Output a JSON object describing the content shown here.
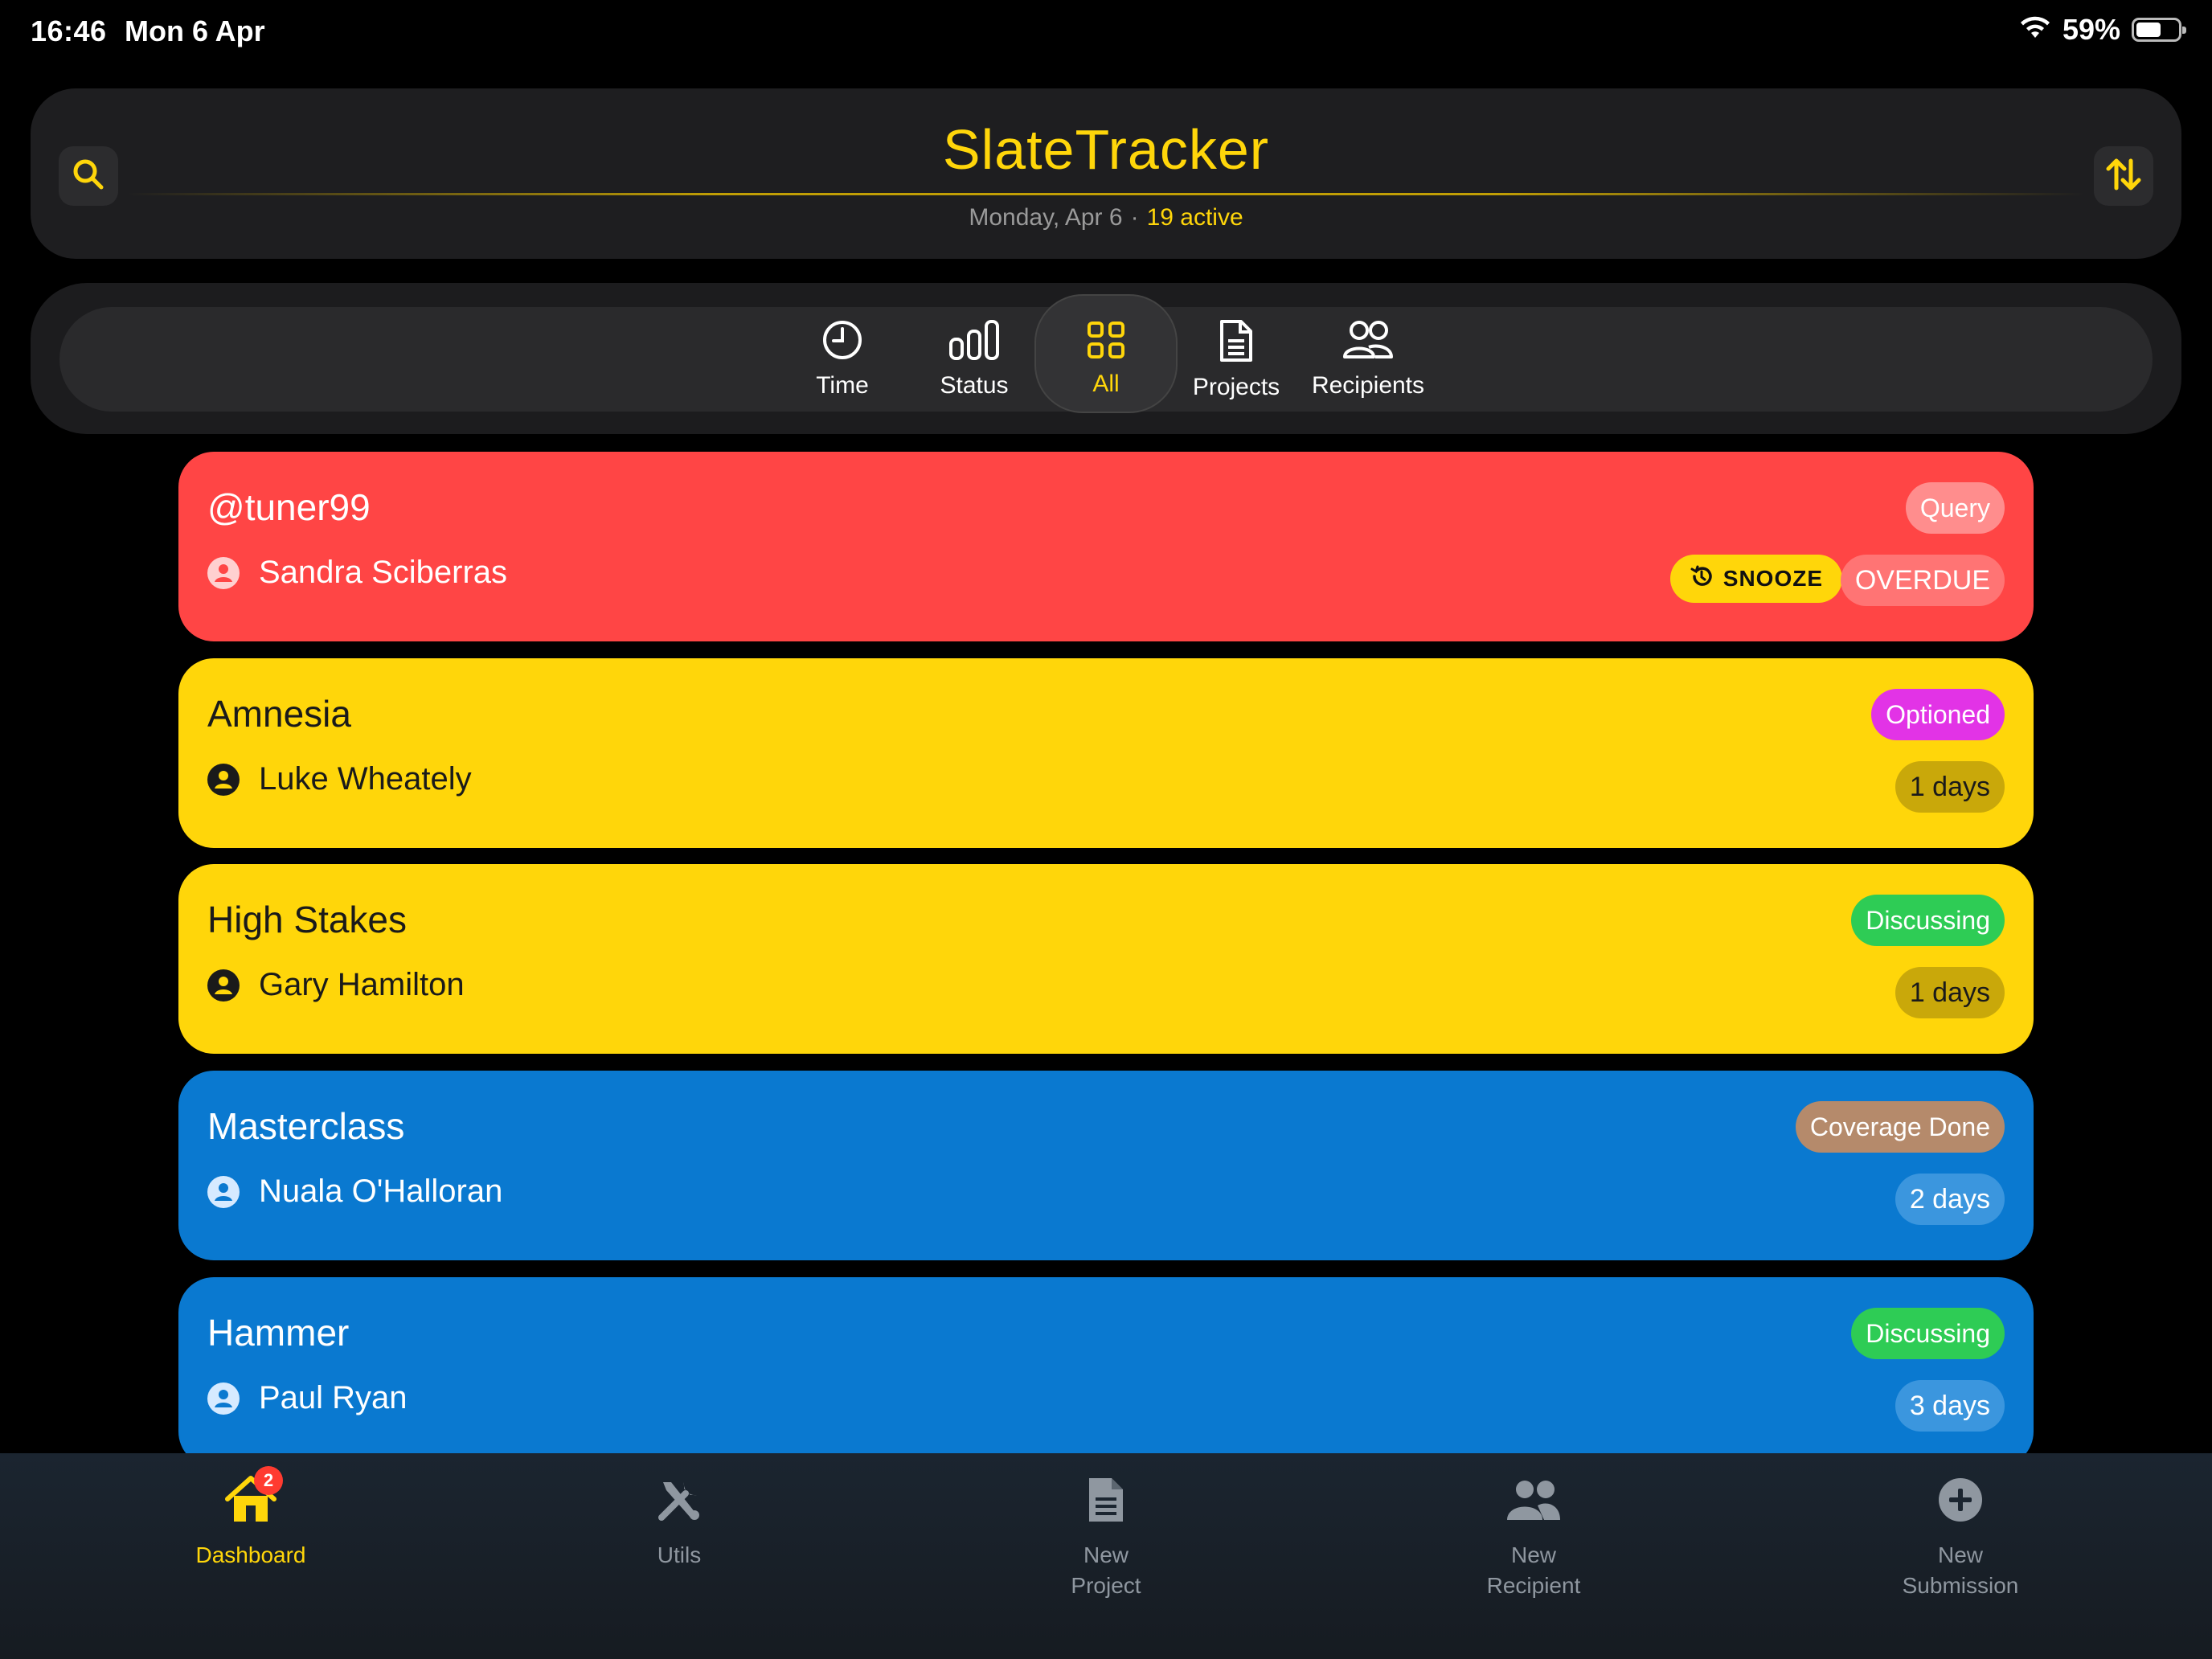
{
  "status_bar": {
    "time": "16:46",
    "date": "Mon 6 Apr",
    "battery": "59%",
    "battery_level": 0.59
  },
  "header": {
    "title": "SlateTracker",
    "date_text": "Monday, Apr 6",
    "separator": "·",
    "active_text": "19 active",
    "search_icon": "search-icon",
    "sort_icon": "sort-arrows-icon"
  },
  "filters": [
    {
      "label": "Time",
      "icon": "clock-icon"
    },
    {
      "label": "Status",
      "icon": "bar-chart-icon"
    },
    {
      "label": "All",
      "icon": "grid-icon",
      "selected": true
    },
    {
      "label": "Projects",
      "icon": "document-icon"
    },
    {
      "label": "Recipients",
      "icon": "people-icon"
    }
  ],
  "cards": [
    {
      "title": "@tuner99",
      "recipient": "Sandra Sciberras",
      "status": "Query",
      "status_color": "#ff8d8d",
      "snooze": "SNOOZE",
      "due": "OVERDUE",
      "color": "#ff4545"
    },
    {
      "title": "Amnesia",
      "recipient": "Luke Wheately",
      "status": "Optioned",
      "status_color": "#e233e6",
      "due": "1 days",
      "color": "#ffd60a"
    },
    {
      "title": "High Stakes",
      "recipient": "Gary Hamilton",
      "status": "Discussing",
      "status_color": "#2ecc55",
      "due": "1 days",
      "color": "#ffd60a"
    },
    {
      "title": "Masterclass",
      "recipient": "Nuala O'Halloran",
      "status": "Coverage Done",
      "status_color": "#b58a6b",
      "due": "2 days",
      "color": "#0a79d0"
    },
    {
      "title": "Hammer",
      "recipient": "Paul Ryan",
      "status": "Discussing",
      "status_color": "#2ecc55",
      "due": "3 days",
      "color": "#0a79d0"
    }
  ],
  "tabbar": [
    {
      "label": "Dashboard",
      "icon": "home-icon",
      "badge": "2",
      "active": true
    },
    {
      "label": "Utils",
      "icon": "tools-icon"
    },
    {
      "label_line1": "New",
      "label_line2": "Project",
      "icon": "new-document-icon"
    },
    {
      "label_line1": "New",
      "label_line2": "Recipient",
      "icon": "people-icon"
    },
    {
      "label_line1": "New",
      "label_line2": "Submission",
      "icon": "plus-circle-icon"
    }
  ]
}
